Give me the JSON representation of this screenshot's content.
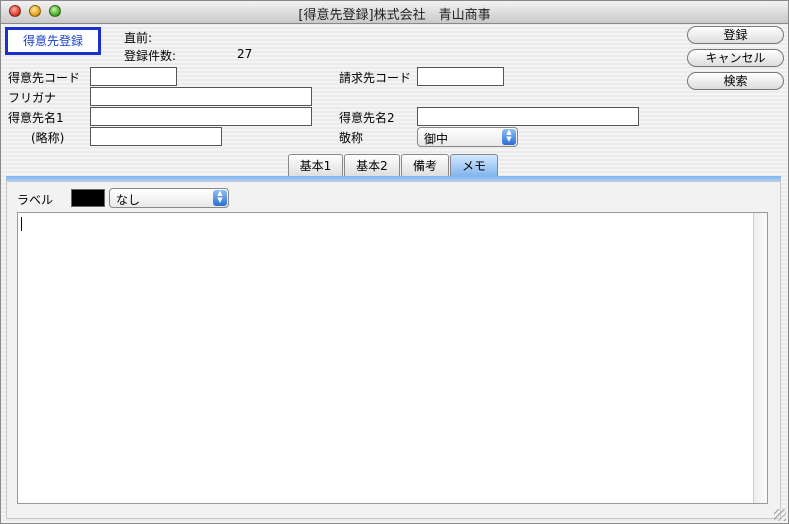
{
  "window": {
    "title": "[得意先登録]株式会社　青山商事"
  },
  "mode": {
    "label": "得意先登録"
  },
  "status": {
    "prev_label": "直前:",
    "count_label": "登録件数:",
    "count_value": "27"
  },
  "buttons": {
    "register": "登録",
    "cancel": "キャンセル",
    "search": "検索"
  },
  "form": {
    "customer_code_label": "得意先コード",
    "customer_code_value": "",
    "furigana_label": "フリガナ",
    "furigana_value": "",
    "name1_label": "得意先名1",
    "name1_value": "",
    "short_label": "(略称)",
    "short_value": "",
    "billing_code_label": "請求先コード",
    "billing_code_value": "",
    "name2_label": "得意先名2",
    "name2_value": "",
    "honorific_label": "敬称",
    "honorific_value": "御中"
  },
  "tabs": [
    {
      "label": "基本1",
      "active": false
    },
    {
      "label": "基本2",
      "active": false
    },
    {
      "label": "備考",
      "active": false
    },
    {
      "label": "メモ",
      "active": true
    }
  ],
  "memo": {
    "label_label": "ラベル",
    "label_color": "#000000",
    "label_value": "なし",
    "text": ""
  },
  "colors": {
    "mode_border": "#1a2fd0",
    "active_tab": "#7fb2ee"
  },
  "icons": {
    "popup_arrows": "updown-arrows-icon"
  }
}
